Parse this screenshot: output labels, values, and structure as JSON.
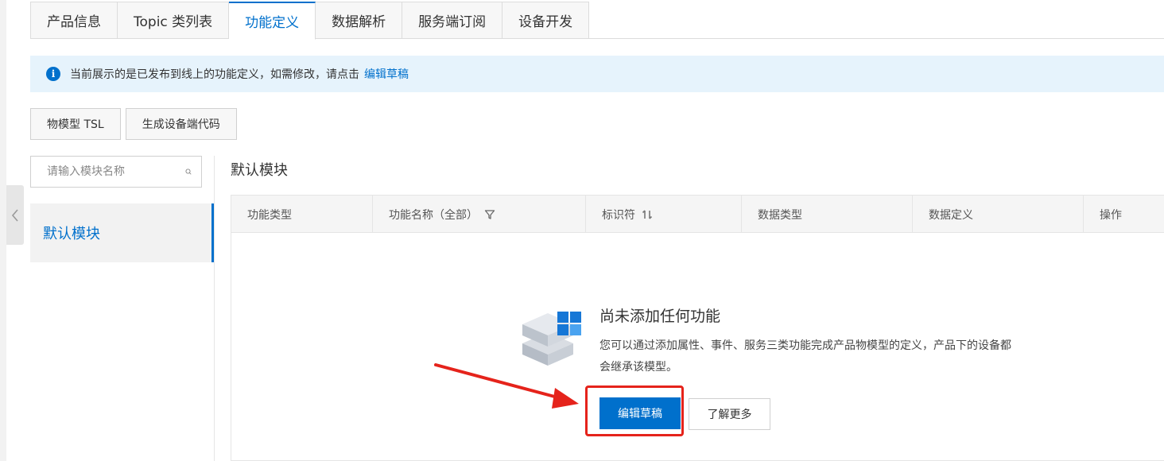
{
  "tabs": [
    {
      "label": "产品信息",
      "active": false
    },
    {
      "label": "Topic 类列表",
      "active": false
    },
    {
      "label": "功能定义",
      "active": true
    },
    {
      "label": "数据解析",
      "active": false
    },
    {
      "label": "服务端订阅",
      "active": false
    },
    {
      "label": "设备开发",
      "active": false
    }
  ],
  "notice": {
    "text": "当前展示的是已发布到线上的功能定义，如需修改，请点击",
    "link": "编辑草稿",
    "icon": "info-icon"
  },
  "toolbar": {
    "tsl_label": "物模型 TSL",
    "codegen_label": "生成设备端代码"
  },
  "module_search": {
    "placeholder": "请输入模块名称"
  },
  "modules": [
    {
      "label": "默认模块",
      "selected": true
    }
  ],
  "main": {
    "module_title": "默认模块"
  },
  "table": {
    "columns": [
      {
        "label": "功能类型"
      },
      {
        "label": "功能名称（全部）",
        "icon": "filter-icon"
      },
      {
        "label": "标识符",
        "icon": "sort-icon"
      },
      {
        "label": "数据类型"
      },
      {
        "label": "数据定义"
      },
      {
        "label": "操作"
      }
    ]
  },
  "empty_state": {
    "title": "尚未添加任何功能",
    "description": "您可以通过添加属性、事件、服务三类功能完成产品物模型的定义，产品下的设备都会继承该模型。",
    "primary_label": "编辑草稿",
    "secondary_label": "了解更多"
  },
  "colors": {
    "accent": "#0070cc",
    "notice_bg": "#e6f3fc",
    "annotation": "#e5231b"
  }
}
